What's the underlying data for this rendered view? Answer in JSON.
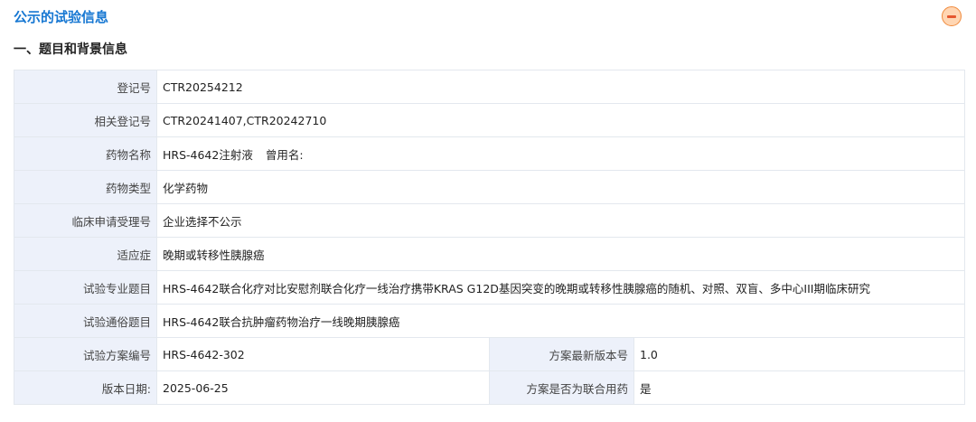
{
  "header": {
    "title": "公示的试验信息",
    "collapse_icon": "minus-circle-icon"
  },
  "section": {
    "title": "一、题目和背景信息"
  },
  "rows": [
    {
      "label": "登记号",
      "value": "CTR20254212"
    },
    {
      "label": "相关登记号",
      "value": "CTR20241407,CTR20242710"
    },
    {
      "label": "药物名称",
      "value": "HRS-4642注射液",
      "extra": "曾用名:"
    },
    {
      "label": "药物类型",
      "value": "化学药物"
    },
    {
      "label": "临床申请受理号",
      "value": "企业选择不公示"
    },
    {
      "label": "适应症",
      "value": "晚期或转移性胰腺癌"
    },
    {
      "label": "试验专业题目",
      "value": "HRS-4642联合化疗对比安慰剂联合化疗一线治疗携带KRAS G12D基因突变的晚期或转移性胰腺癌的随机、对照、双盲、多中心III期临床研究"
    },
    {
      "label": "试验通俗题目",
      "value": "HRS-4642联合抗肿瘤药物治疗一线晚期胰腺癌"
    }
  ],
  "split_rows": [
    {
      "label": "试验方案编号",
      "value": "HRS-4642-302",
      "label2": "方案最新版本号",
      "value2": "1.0"
    },
    {
      "label": "版本日期:",
      "value": "2025-06-25",
      "label2": "方案是否为联合用药",
      "value2": "是"
    }
  ],
  "colors": {
    "title": "#1677d2",
    "label_bg": "#edf1fa",
    "border": "#e3e8ee",
    "collapse_fill": "#ffd6b3",
    "collapse_accent": "#e5572f"
  }
}
